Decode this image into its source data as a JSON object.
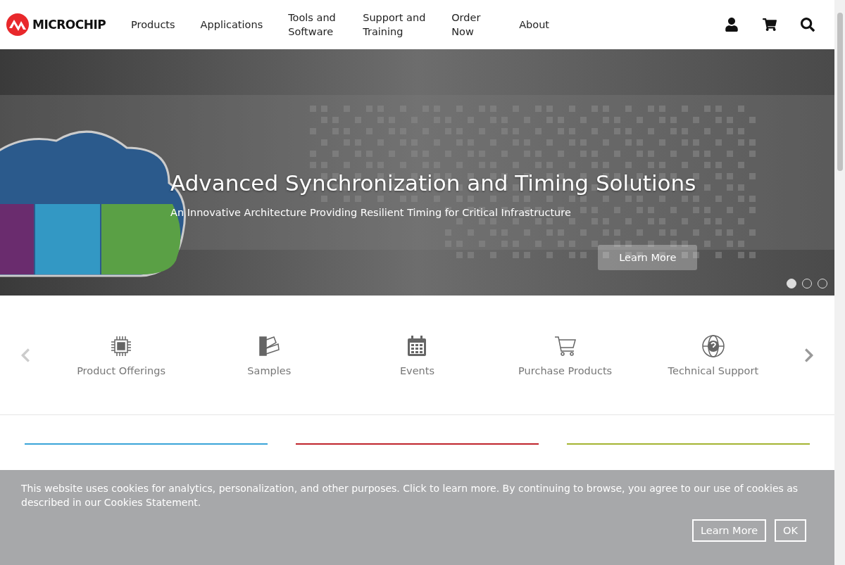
{
  "header": {
    "logo": "MICROCHIP",
    "nav": [
      {
        "label": "Products"
      },
      {
        "label": "Applications"
      },
      {
        "label": "Tools and Software"
      },
      {
        "label": "Support and Training"
      },
      {
        "label": "Order Now"
      },
      {
        "label": "About"
      }
    ]
  },
  "hero": {
    "kind": "picture",
    "title": "Advanced Synchronization and Timing Solutions",
    "subtitle": "An Innovative Architecture Providing Resilient Timing for Critical Infrastructure",
    "button": "Learn More",
    "dots": [
      {
        "selected": true
      },
      {
        "selected": false
      },
      {
        "selected": false
      }
    ]
  },
  "quick_links": [
    {
      "label": "Product Offerings"
    },
    {
      "label": "Samples"
    },
    {
      "label": "Events"
    },
    {
      "label": "Purchase Products"
    },
    {
      "label": "Technical Support"
    }
  ],
  "columns": [
    {
      "color": "#3aa4d8"
    },
    {
      "color": "#c0242c"
    },
    {
      "color": "#a4b431"
    }
  ],
  "cookie_banner": {
    "text": "This website uses cookies for analytics, personalization, and other purposes. Click to learn more. By continuing to browse, you agree to our use of cookies as described in our Cookies Statement.",
    "buttons": [
      "Learn More",
      "OK"
    ]
  }
}
